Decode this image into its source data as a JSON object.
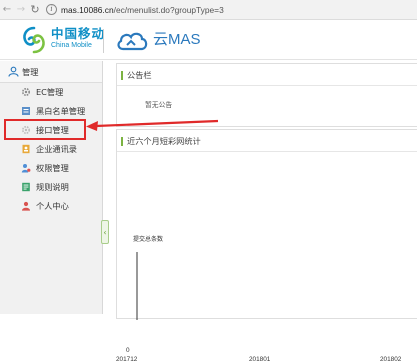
{
  "browser": {
    "back_icon": "back-arrow-icon",
    "forward_icon": "forward-arrow-icon",
    "reload_icon": "reload-icon",
    "url_host": "mas.10086.cn",
    "url_path": "/ec/menulist.do?groupType=3"
  },
  "header": {
    "brand_cn": "中国移动",
    "brand_en": "China Mobile",
    "product_name": "云MAS",
    "brand_color": "#0f8fc6"
  },
  "sidebar": {
    "title": "管理",
    "items": [
      {
        "label": "EC管理",
        "icon": "gear-icon"
      },
      {
        "label": "黑白名单管理",
        "icon": "list-icon"
      },
      {
        "label": "接口管理",
        "icon": "gear-icon"
      },
      {
        "label": "企业通讯录",
        "icon": "contacts-icon"
      },
      {
        "label": "权限管理",
        "icon": "permission-icon"
      },
      {
        "label": "规则说明",
        "icon": "rules-icon"
      },
      {
        "label": "个人中心",
        "icon": "user-icon"
      }
    ],
    "collapse_glyph": "‹",
    "highlighted_item": "接口管理",
    "highlight_color": "#e02a2a"
  },
  "notice": {
    "title": "公告栏",
    "body": "暂无公告"
  },
  "stats": {
    "title": "近六个月短彩网统计"
  },
  "chart_data": {
    "type": "bar",
    "ylabel": "提交总条数",
    "categories": [
      "201712",
      "201801",
      "201802"
    ],
    "values": [
      0,
      0,
      0
    ],
    "y_tick_labels": [
      "0"
    ],
    "grid": false
  },
  "accent_color": "#7cb342"
}
